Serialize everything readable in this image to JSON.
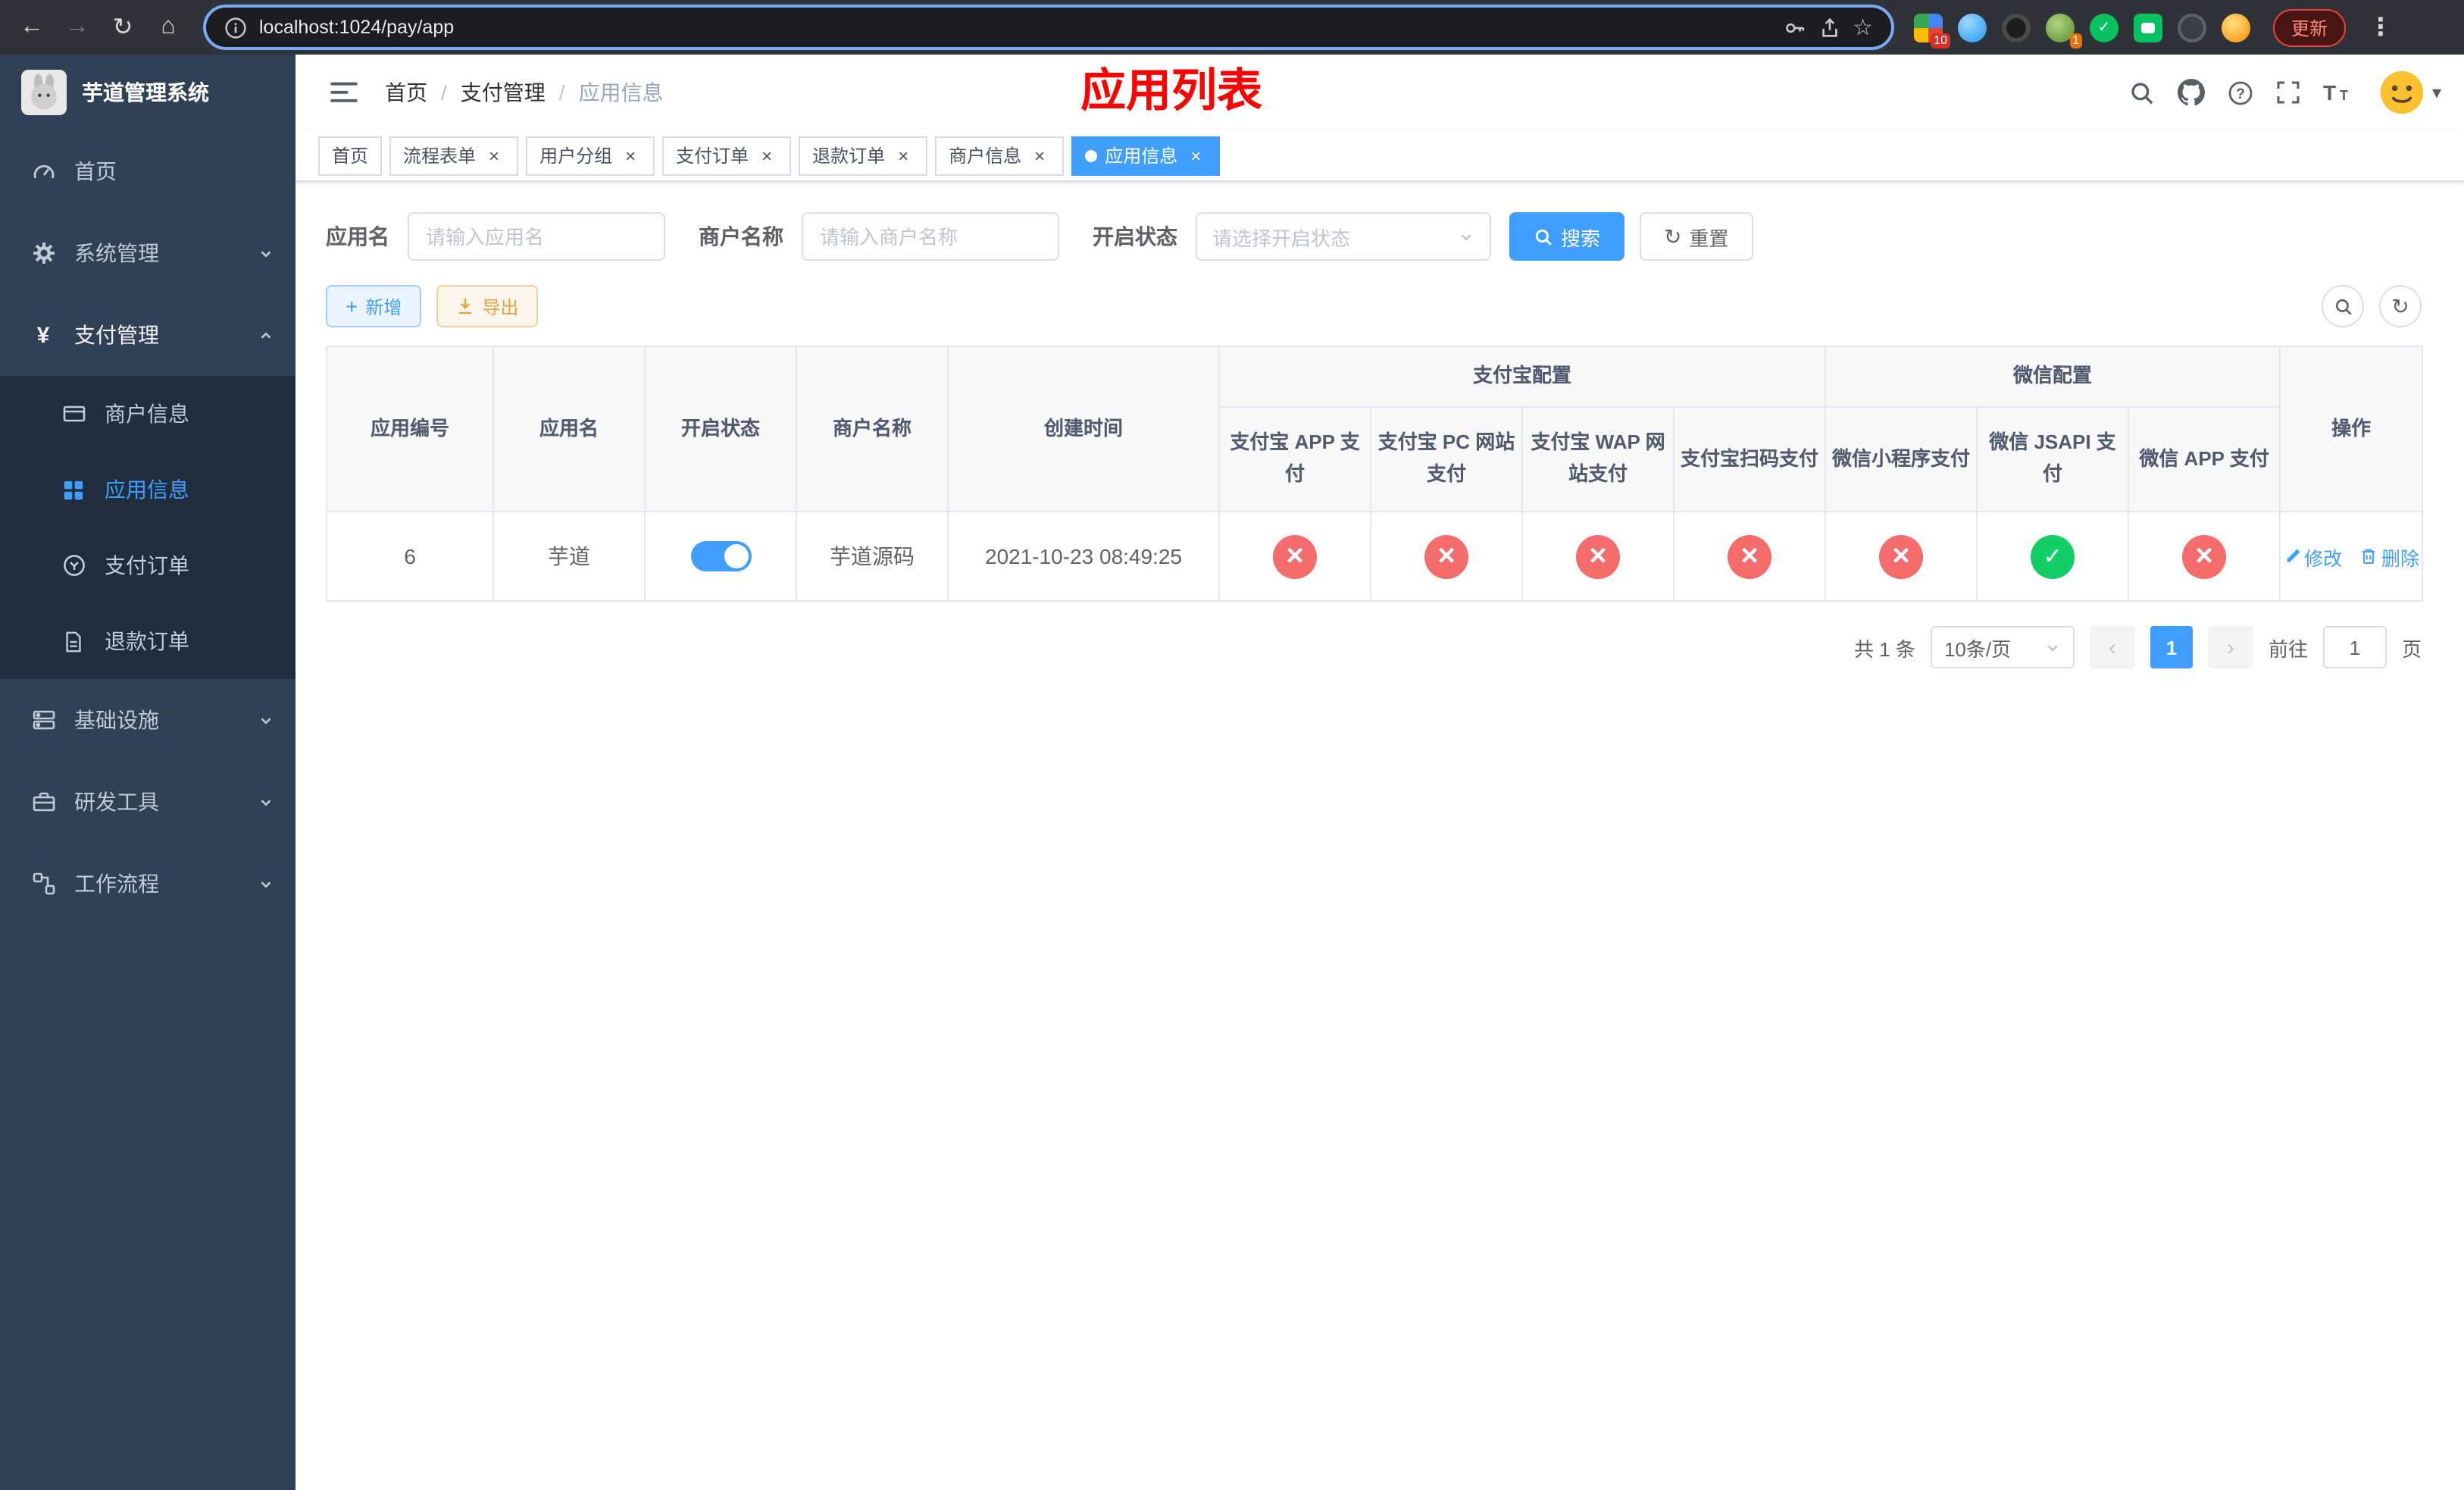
{
  "browser": {
    "url": "localhost:1024/pay/app",
    "update_button": "更新",
    "ext_badges": {
      "first": "10",
      "avatar": "1"
    }
  },
  "sidebar": {
    "title": "芋道管理系统",
    "items": [
      {
        "label": "首页"
      },
      {
        "label": "系统管理"
      },
      {
        "label": "支付管理",
        "children": [
          {
            "label": "商户信息"
          },
          {
            "label": "应用信息"
          },
          {
            "label": "支付订单"
          },
          {
            "label": "退款订单"
          }
        ]
      },
      {
        "label": "基础设施"
      },
      {
        "label": "研发工具"
      },
      {
        "label": "工作流程"
      }
    ]
  },
  "header": {
    "breadcrumb": {
      "home": "首页",
      "section": "支付管理",
      "current": "应用信息"
    },
    "page_title": "应用列表"
  },
  "tabs": [
    {
      "label": "首页"
    },
    {
      "label": "流程表单"
    },
    {
      "label": "用户分组"
    },
    {
      "label": "支付订单"
    },
    {
      "label": "退款订单"
    },
    {
      "label": "商户信息"
    },
    {
      "label": "应用信息"
    }
  ],
  "filters": {
    "app_name": {
      "label": "应用名",
      "placeholder": "请输入应用名"
    },
    "merchant_name": {
      "label": "商户名称",
      "placeholder": "请输入商户名称"
    },
    "status": {
      "label": "开启状态",
      "placeholder": "请选择开启状态"
    },
    "search_button": "搜索",
    "reset_button": "重置"
  },
  "toolbar": {
    "add_button": "新增",
    "export_button": "导出"
  },
  "table": {
    "groups": {
      "alipay": "支付宝配置",
      "wechat": "微信配置"
    },
    "columns": {
      "id": "应用编号",
      "app_name": "应用名",
      "status": "开启状态",
      "merchant": "商户名称",
      "created": "创建时间",
      "alipay_app": "支付宝 APP 支付",
      "alipay_pc": "支付宝 PC 网站支付",
      "alipay_wap": "支付宝 WAP 网站支付",
      "alipay_qr": "支付宝扫码支付",
      "wx_mini": "微信小程序支付",
      "wx_jsapi": "微信 JSAPI 支付",
      "wx_app": "微信 APP 支付",
      "ops": "操作"
    },
    "rows": [
      {
        "id": "6",
        "app_name": "芋道",
        "status_on": true,
        "merchant": "芋道源码",
        "created": "2021-10-23 08:49:25",
        "alipay_app": "no",
        "alipay_pc": "no",
        "alipay_wap": "no",
        "alipay_qr": "no",
        "wx_mini": "no",
        "wx_jsapi": "yes",
        "wx_app": "no",
        "edit": "修改",
        "delete": "删除"
      }
    ]
  },
  "pagination": {
    "total": "共 1 条",
    "page_size": "10条/页",
    "page": "1",
    "goto_label": "前往",
    "goto_value": "1",
    "goto_unit": "页"
  }
}
